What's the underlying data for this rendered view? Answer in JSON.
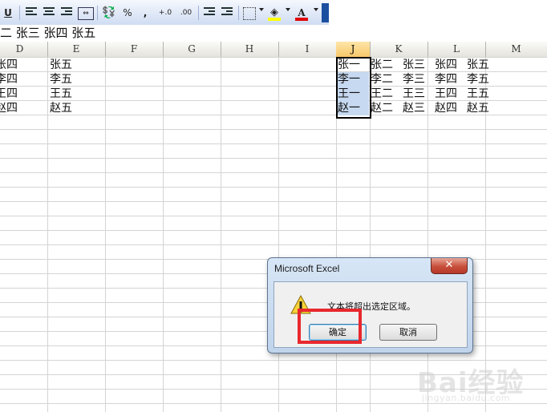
{
  "toolbar": {
    "underline_label": "U",
    "percent_label": "%",
    "comma_label": ",",
    "increase_decimal_label": "+.0",
    "decrease_decimal_label": ".00",
    "font_color_label": "A",
    "fill_color": "#ffff00",
    "font_color": "#e00000"
  },
  "formula_bar": {
    "value": "二  张三  张四  张五"
  },
  "columns": [
    "D",
    "E",
    "F",
    "G",
    "H",
    "I",
    "J",
    "K",
    "L",
    "M"
  ],
  "active_column": "J",
  "rows": [
    {
      "d": "张四",
      "e": "张五",
      "j": "张一",
      "k": "张二",
      "l": "张三",
      "m1": "张四",
      "m2": "张五"
    },
    {
      "d": "李四",
      "e": "李五",
      "j": "李一",
      "k": "李二",
      "l": "李三",
      "m1": "李四",
      "m2": "李五"
    },
    {
      "d": "王四",
      "e": "王五",
      "j": "王一",
      "k": "王二",
      "l": "王三",
      "m1": "王四",
      "m2": "王五"
    },
    {
      "d": "赵四",
      "e": "赵五",
      "j": "赵一",
      "k": "赵二",
      "l": "赵三",
      "m1": "赵四",
      "m2": "赵五"
    }
  ],
  "dialog": {
    "title": "Microsoft Excel",
    "close": "✕",
    "message": "文本将超出选定区域。",
    "ok_label": "确定",
    "cancel_label": "取消"
  },
  "watermark": {
    "text": "Bai经验",
    "sub": "jingyan.baidu.com"
  }
}
